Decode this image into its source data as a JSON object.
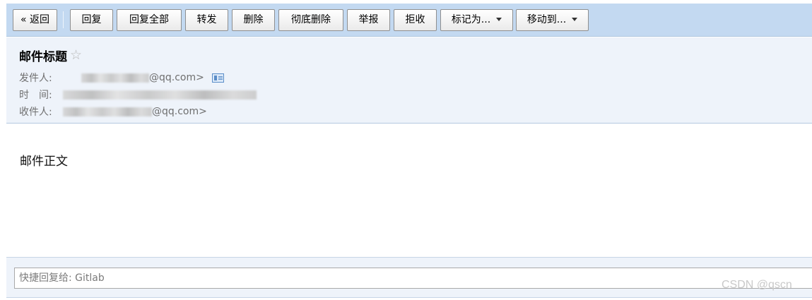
{
  "toolbar": {
    "back": "« 返回",
    "reply": "回复",
    "reply_all": "回复全部",
    "forward": "转发",
    "delete": "删除",
    "delete_permanently": "彻底删除",
    "report": "举报",
    "reject": "拒收",
    "mark_as": "标记为...",
    "move_to": "移动到..."
  },
  "header": {
    "subject": "邮件标题",
    "star_glyph": "☆",
    "sender_label": "发件人:",
    "sender_addr": "@qq.com>",
    "time_label": "时　间:",
    "recipient_label": "收件人:",
    "recipient_addr": "@qq.com>"
  },
  "body": {
    "text": "邮件正文"
  },
  "quick_reply": {
    "placeholder": "快捷回复给: Gitlab"
  },
  "watermark": "CSDN @qscn",
  "icons": {
    "star": "star-icon",
    "contact_card": "contact-card-icon",
    "dropdown": "caret-down-icon"
  },
  "colors": {
    "toolbar_bg": "#c3d9f1",
    "header_bg": "#eef3fa",
    "meta_text": "#6f6f6f"
  }
}
